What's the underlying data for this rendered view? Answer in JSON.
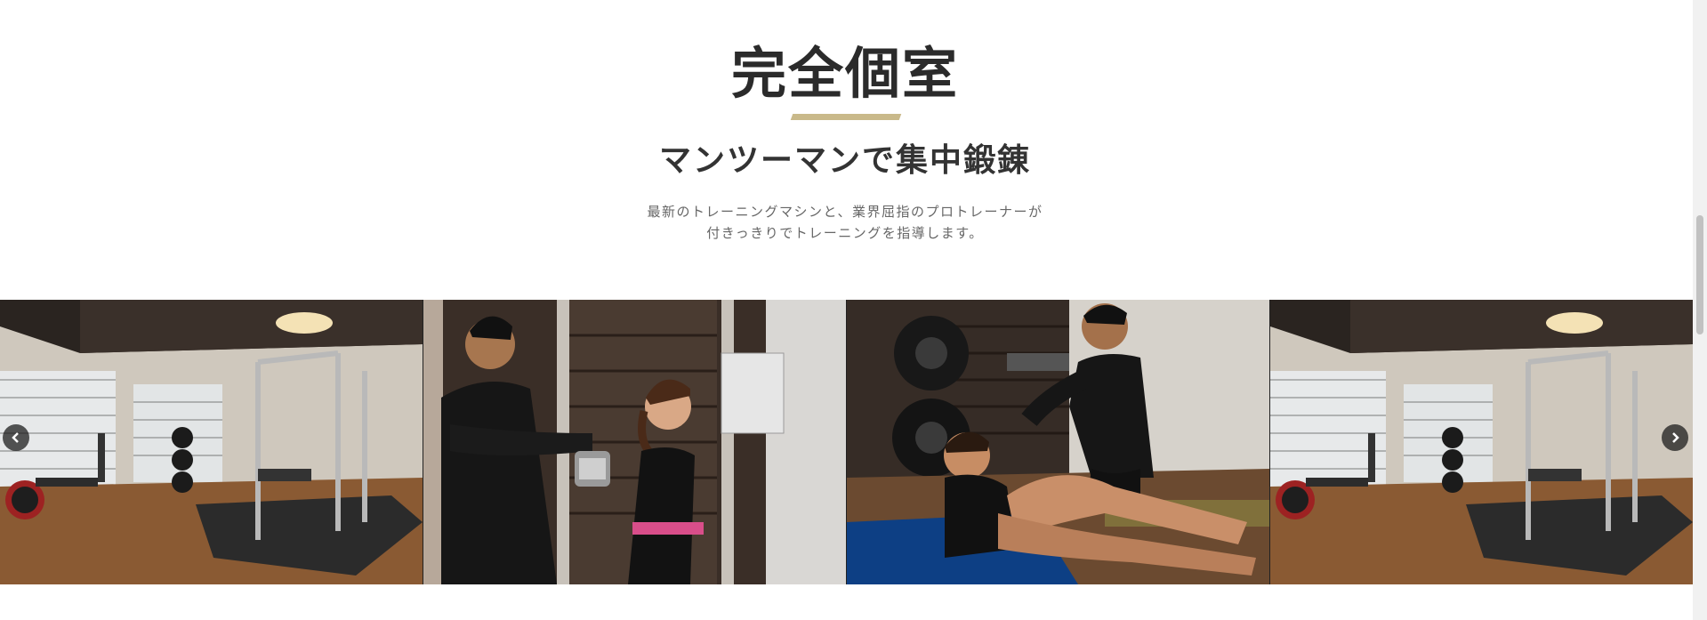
{
  "section": {
    "title": "完全個室",
    "subtitle": "マンツーマンで集中鍛錬",
    "description_line1": "最新のトレーニングマシンと、業界屈指のプロトレーナーが",
    "description_line2": "付きっきりでトレーニングを指導します。",
    "accent_color": "#c9b98a"
  },
  "slider": {
    "slides": [
      {
        "icon": "gym-room-photo"
      },
      {
        "icon": "trainer-squat-photo"
      },
      {
        "icon": "trainer-situp-photo"
      },
      {
        "icon": "gym-room-photo"
      }
    ],
    "prev_icon": "chevron-left-icon",
    "next_icon": "chevron-right-icon"
  }
}
